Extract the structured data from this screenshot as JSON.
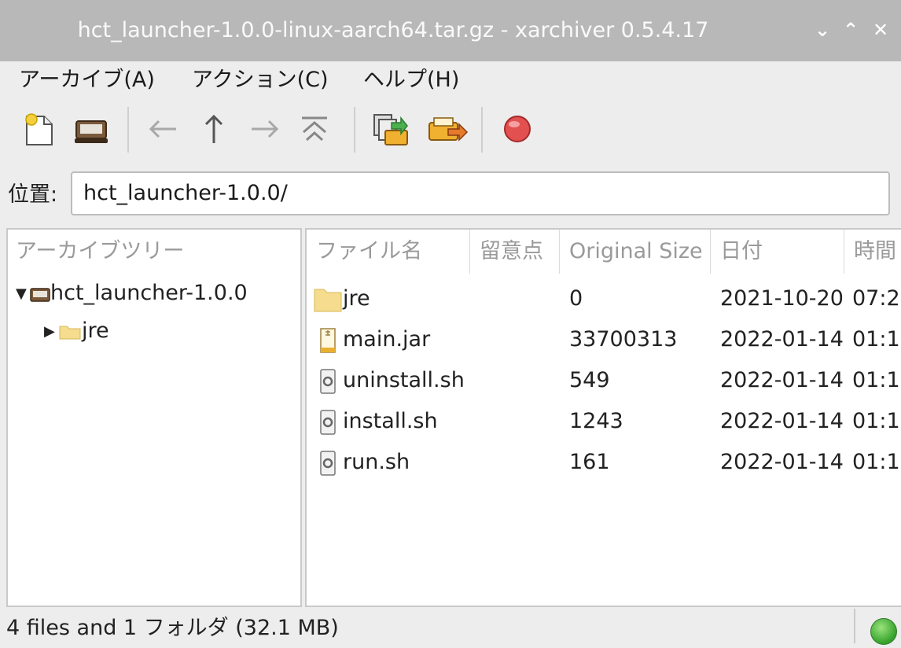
{
  "window": {
    "title": "hct_launcher-1.0.0-linux-aarch64.tar.gz - xarchiver 0.5.4.17"
  },
  "menubar": {
    "items": [
      {
        "label": "アーカイブ(A)"
      },
      {
        "label": "アクション(C)"
      },
      {
        "label": "ヘルプ(H)"
      }
    ]
  },
  "toolbar": {
    "buttons": [
      "new-archive-icon",
      "open-archive-icon",
      "back-arrow-icon",
      "up-arrow-icon",
      "forward-arrow-icon",
      "home-icon",
      "extract-icon",
      "add-icon",
      "stop-icon"
    ]
  },
  "location": {
    "label": "位置:",
    "value": "hct_launcher-1.0.0/"
  },
  "tree": {
    "header": "アーカイブツリー",
    "items": [
      {
        "label": "hct_launcher-1.0.0",
        "expanded": true
      },
      {
        "label": "jre",
        "expanded": false
      }
    ]
  },
  "filelist": {
    "headers": {
      "name": "ファイル名",
      "note": "留意点",
      "size": "Original Size",
      "date": "日付",
      "time": "時間"
    },
    "rows": [
      {
        "name": "jre",
        "type": "folder",
        "size": "0",
        "date": "2021-10-20",
        "time": "07:2"
      },
      {
        "name": "main.jar",
        "type": "jar",
        "size": "33700313",
        "date": "2022-01-14",
        "time": "01:1"
      },
      {
        "name": "uninstall.sh",
        "type": "script",
        "size": "549",
        "date": "2022-01-14",
        "time": "01:1"
      },
      {
        "name": "install.sh",
        "type": "script",
        "size": "1243",
        "date": "2022-01-14",
        "time": "01:1"
      },
      {
        "name": "run.sh",
        "type": "script",
        "size": "161",
        "date": "2022-01-14",
        "time": "01:1"
      }
    ]
  },
  "status": {
    "text": "4 files and 1 フォルダ  (32.1 MB)",
    "indicator_color": "#33a12a"
  },
  "colors": {
    "titlebar": "#b8b8b8",
    "folder": "#f5dc8e"
  }
}
